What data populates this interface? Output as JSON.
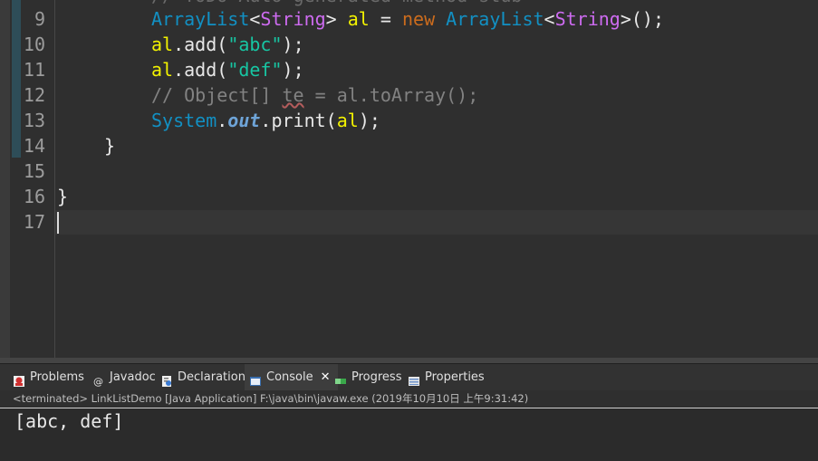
{
  "editor": {
    "line_numbers": [
      "9",
      "10",
      "11",
      "12",
      "13",
      "14",
      "15",
      "16",
      "17"
    ],
    "top_partial_comment": "// TODO Auto-generated method stub",
    "line9": {
      "type1": "ArrayList",
      "lt1": "<",
      "gen1": "String",
      "gt1": "> ",
      "var": "al",
      "eq": " = ",
      "new": "new",
      "type2": " ArrayList",
      "lt2": "<",
      "gen2": "String",
      "rest": ">();"
    },
    "line10": {
      "var": "al",
      "call": ".add(",
      "str": "\"abc\"",
      "end": ");"
    },
    "line11": {
      "var": "al",
      "call": ".add(",
      "str": "\"def\"",
      "end": ");"
    },
    "line12": {
      "c1": "// Object[] ",
      "c2": "te",
      "c3": " = al.toArray();"
    },
    "line13": {
      "type": "System",
      "dot1": ".",
      "field": "out",
      "call": ".print(",
      "var": "al",
      "end": ");"
    },
    "line14": "}",
    "line16": "}"
  },
  "panel": {
    "tabs": [
      {
        "label": "Problems"
      },
      {
        "label": "Javadoc"
      },
      {
        "label": "Declaration"
      },
      {
        "label": "Console"
      },
      {
        "label": "Progress"
      },
      {
        "label": "Properties"
      }
    ],
    "close_symbol": "✕"
  },
  "console": {
    "header": "<terminated> LinkListDemo [Java Application] F:\\java\\bin\\javaw.exe (2019年10月10日 上午9:31:42)",
    "output": "[abc, def]"
  }
}
